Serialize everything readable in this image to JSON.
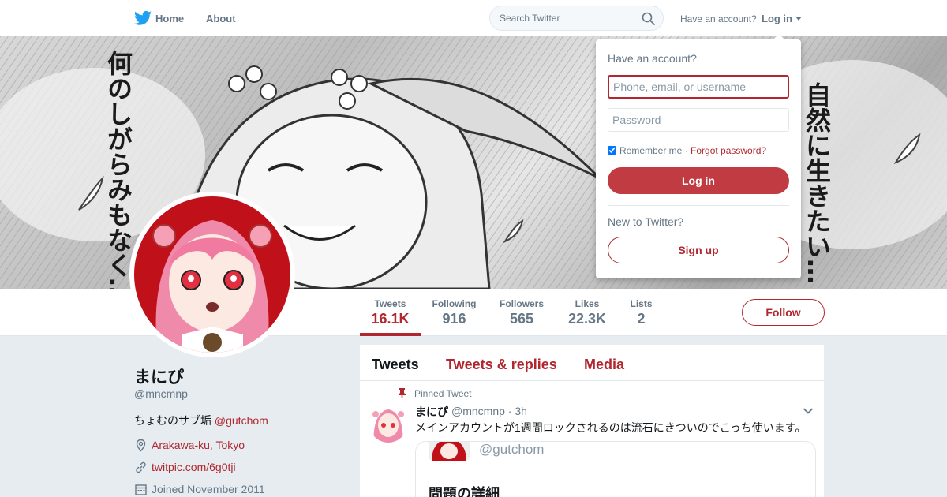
{
  "nav": {
    "home_label": "Home",
    "about_label": "About",
    "search_placeholder": "Search Twitter",
    "have_account": "Have an account?",
    "login_label": "Log in"
  },
  "header_art": {
    "left_text": "何のしがらみもなく…",
    "right_text": "自然に生きたい…"
  },
  "profile_nav": {
    "stats": [
      {
        "label": "Tweets",
        "value": "16.1K",
        "active": true
      },
      {
        "label": "Following",
        "value": "916"
      },
      {
        "label": "Followers",
        "value": "565"
      },
      {
        "label": "Likes",
        "value": "22.3K"
      },
      {
        "label": "Lists",
        "value": "2"
      }
    ],
    "follow_label": "Follow"
  },
  "profile": {
    "name": "まにぴ",
    "handle": "@mncmnp",
    "bio_text": "ちょむのサブ垢 ",
    "bio_link": "@gutchom",
    "location": "Arakawa-ku, Tokyo",
    "website": "twitpic.com/6g0tji",
    "joined": "Joined November 2011"
  },
  "timeline": {
    "tabs": [
      "Tweets",
      "Tweets & replies",
      "Media"
    ],
    "pinned_label": "Pinned Tweet",
    "tweet": {
      "name": "まにぴ",
      "handle_time": "@mncmnp · 3h",
      "text": "メインアカウントが1週間ロックされるのは流石にきついのでこっち使います。",
      "quote_handle": "@gutchom",
      "quote_title": "問題の詳細"
    }
  },
  "login_panel": {
    "heading": "Have an account?",
    "username_placeholder": "Phone, email, or username",
    "password_placeholder": "Password",
    "remember_label": "Remember me",
    "separator": " · ",
    "forgot_label": "Forgot password?",
    "login_button": "Log in",
    "new_label": "New to Twitter?",
    "signup_button": "Sign up"
  },
  "colors": {
    "accent": "#b0272f",
    "login_button": "#c03b42",
    "muted": "#657786",
    "background": "#e6ecf0"
  }
}
